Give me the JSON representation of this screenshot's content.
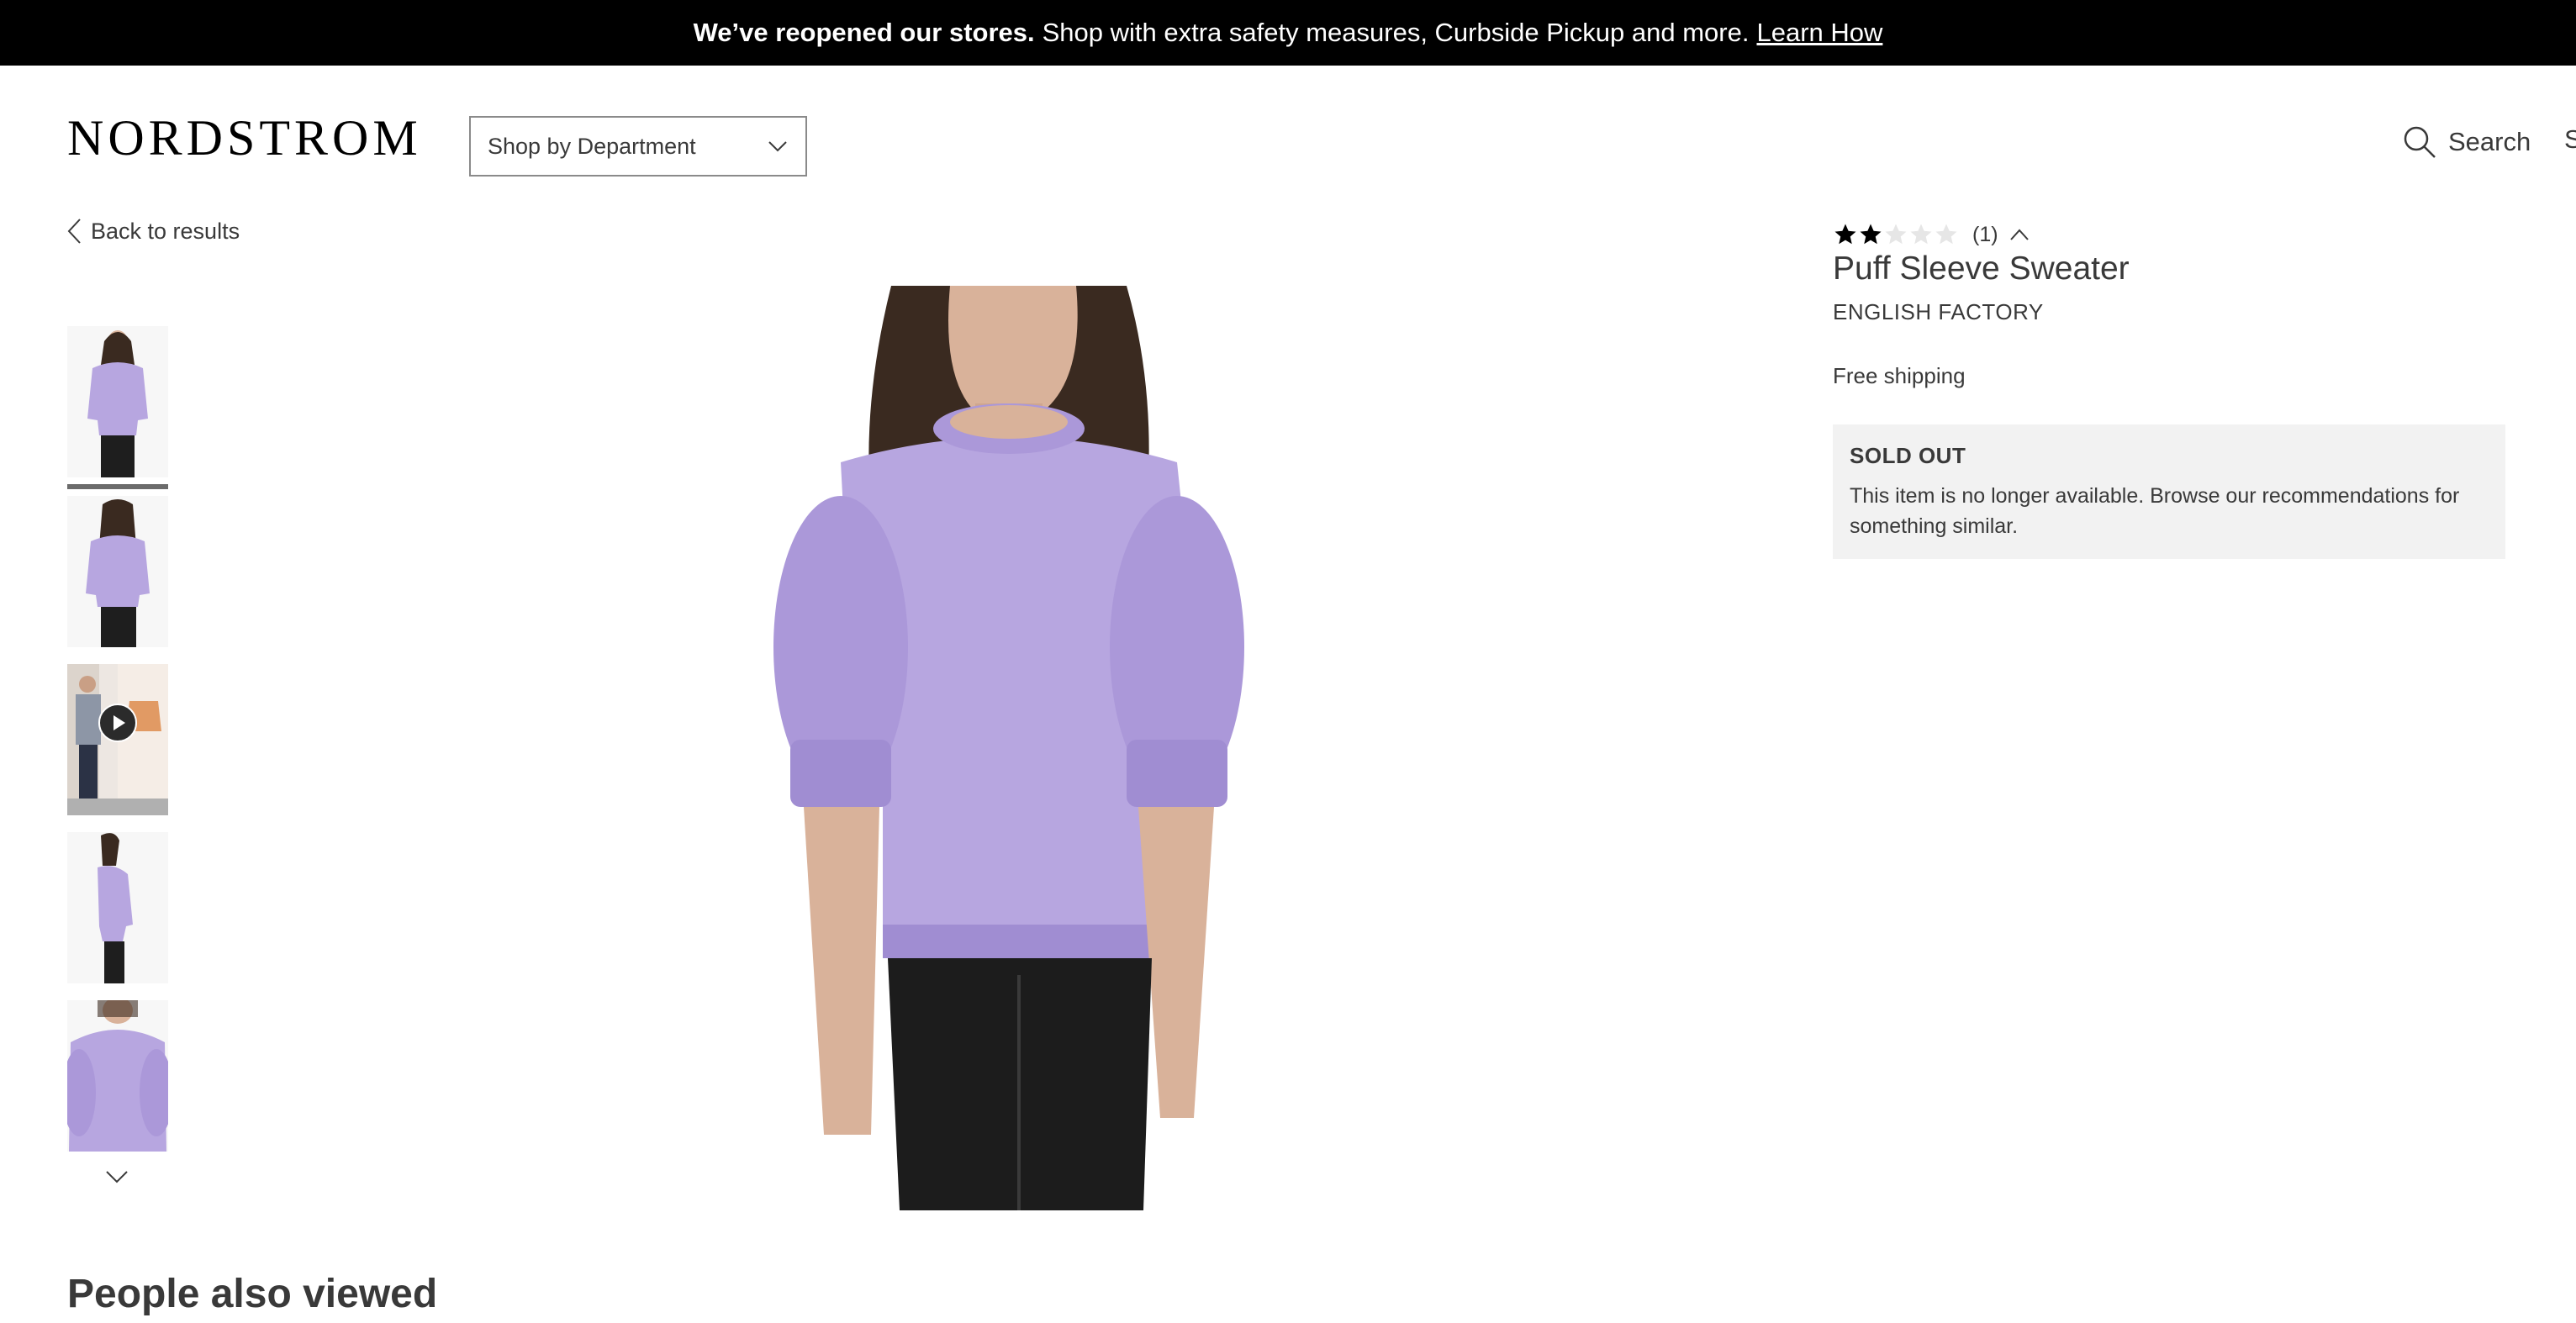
{
  "announcement": {
    "strong": "We’ve reopened our stores.",
    "text": "Shop with extra safety measures, Curbside Pickup and more.",
    "link": "Learn How"
  },
  "header": {
    "logo": "NORDSTROM",
    "department_select": "Shop by Department",
    "search_label": "Search",
    "cut_label": "S"
  },
  "nav": {
    "back_label": "Back to results"
  },
  "gallery": {
    "thumbnails": [
      {
        "name": "front",
        "video": false
      },
      {
        "name": "back",
        "video": false
      },
      {
        "name": "video",
        "video": true
      },
      {
        "name": "side",
        "video": false
      },
      {
        "name": "detail",
        "video": false
      }
    ],
    "sweater_color": "#b7a6e0"
  },
  "product": {
    "rating_value": 2,
    "rating_max": 5,
    "review_count": "(1)",
    "name": "Puff Sleeve Sweater",
    "brand": "ENGLISH FACTORY",
    "shipping": "Free shipping",
    "status_title": "SOLD OUT",
    "status_text": "This item is no longer available. Browse our recommendations for something similar."
  },
  "section_title": "People also viewed"
}
